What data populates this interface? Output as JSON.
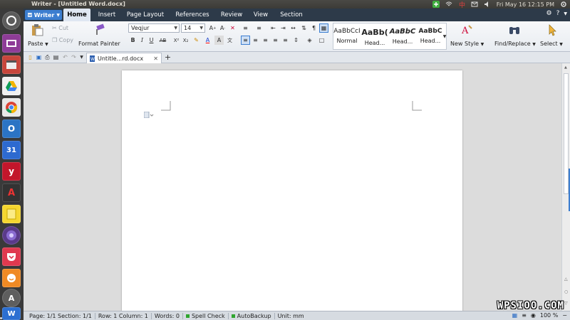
{
  "topbar": {
    "title": "Writer - [Untitled Word.docx]",
    "datetime": "Fri May 16 12:15 PM"
  },
  "menubar": {
    "app_button": "Writer",
    "tabs": [
      "Home",
      "Insert",
      "Page Layout",
      "References",
      "Review",
      "View",
      "Section"
    ],
    "active_tab": "Home",
    "right_icons": [
      "settings-icon",
      "help-icon"
    ]
  },
  "ribbon": {
    "clipboard": {
      "paste": "Paste",
      "cut": "Cut",
      "copy": "Copy",
      "format_painter": "Format Painter"
    },
    "font": {
      "name": "Veqjur",
      "size": "14"
    },
    "styles": [
      {
        "sample": "AaBbCcI",
        "name": "Normal"
      },
      {
        "sample": "AaBb(",
        "name": "Head..."
      },
      {
        "sample": "AaBbC",
        "name": "Head..."
      },
      {
        "sample": "AaBbC",
        "name": "Head..."
      }
    ],
    "new_style": "New Style",
    "find_replace": "Find/Replace",
    "select": "Select"
  },
  "document_tab": {
    "name": "Untitle...rd.docx",
    "add_label": "+"
  },
  "statusbar": {
    "page": "Page: 1/1 Section: 1/1",
    "row_col": "Row: 1 Column: 1",
    "words": "Words: 0",
    "spell_check": "Spell Check",
    "auto_backup": "AutoBackup",
    "unit": "Unit: mm",
    "zoom": "100 %"
  },
  "watermark": "WPSIOO.COM",
  "colors": {
    "menubar": "#2d3a49",
    "accent": "#3c7ed0",
    "launcher": "#3a3a3a"
  }
}
